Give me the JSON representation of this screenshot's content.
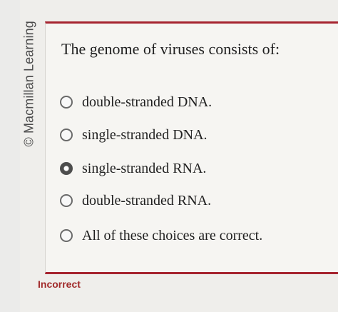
{
  "watermark": {
    "text": "© Macmillan Learning"
  },
  "question": {
    "text": "The genome of viruses consists of:"
  },
  "choices": [
    {
      "label": "double-stranded DNA.",
      "selected": false
    },
    {
      "label": "single-stranded DNA.",
      "selected": false
    },
    {
      "label": "single-stranded RNA.",
      "selected": true
    },
    {
      "label": "double-stranded RNA.",
      "selected": false
    },
    {
      "label": "All of these choices are correct.",
      "selected": false
    }
  ],
  "feedback": {
    "text": "Incorrect"
  },
  "colors": {
    "accent": "#a6242f",
    "feedback": "#a12a2a",
    "radio_border": "#6a6a6a",
    "radio_fill": "#4d4d4d"
  }
}
